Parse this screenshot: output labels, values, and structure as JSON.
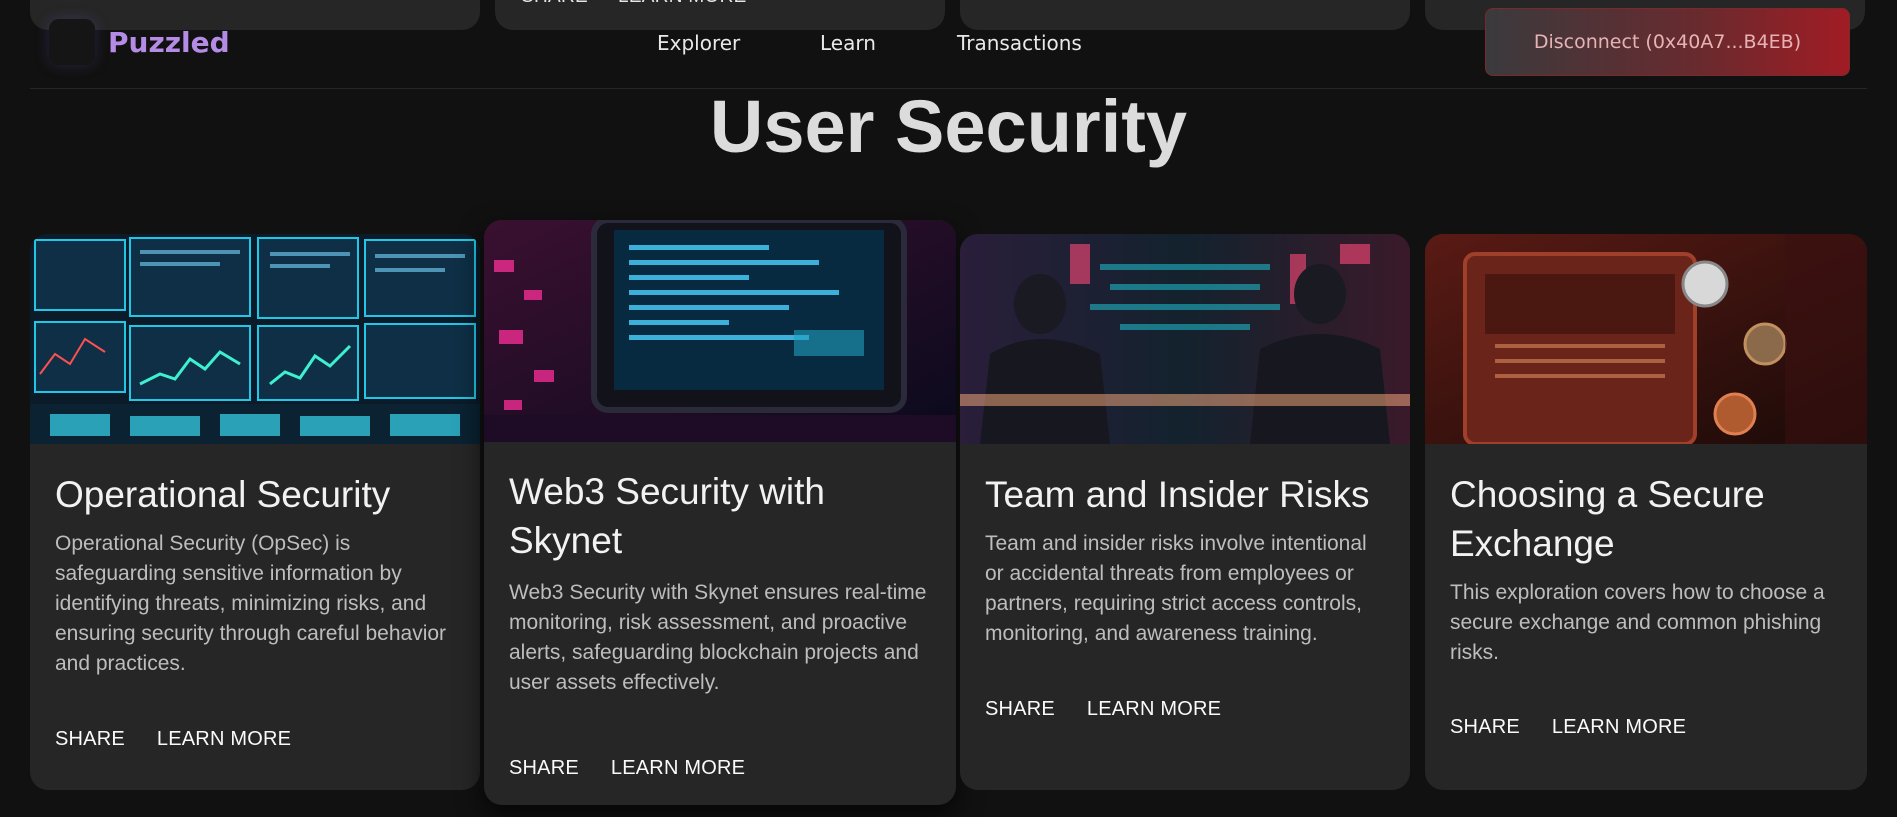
{
  "ghost": {
    "share_label": "SHARE",
    "learn_more_label": "LEARN MORE"
  },
  "header": {
    "brand": "Puzzled",
    "nav": [
      "Explorer",
      "Learn",
      "Transactions"
    ],
    "disconnect_label": "Disconnect (0x40A7...B4EB)"
  },
  "page": {
    "title": "User Security"
  },
  "cards": [
    {
      "title": "Operational Security",
      "description": "Operational Security (OpSec) is safeguarding sensitive information by identifying threats, minimizing risks, and ensuring security through careful behavior and practices.",
      "share": "SHARE",
      "learn_more": "LEARN MORE",
      "image_icon": "trading-screens-image"
    },
    {
      "title": "Web3 Security with Skynet",
      "description": "Web3 Security with Skynet ensures real-time monitoring, risk assessment, and proactive alerts, safeguarding blockchain projects and user assets effectively.",
      "share": "SHARE",
      "learn_more": "LEARN MORE",
      "image_icon": "code-monitor-image"
    },
    {
      "title": "Team and Insider Risks",
      "description": "Team and insider risks involve intentional or accidental threats from employees or partners, requiring strict access controls, monitoring, and awareness training.",
      "share": "SHARE",
      "learn_more": "LEARN MORE",
      "image_icon": "hackers-image"
    },
    {
      "title": "Choosing a Secure Exchange",
      "description": "This exploration covers how to choose a secure exchange and common phishing risks.",
      "share": "SHARE",
      "learn_more": "LEARN MORE",
      "image_icon": "crypto-wallet-image"
    }
  ],
  "colors": {
    "background": "#111111",
    "card": "#262626",
    "brand": "#b48ce6",
    "disconnect_red": "#a11c24"
  }
}
